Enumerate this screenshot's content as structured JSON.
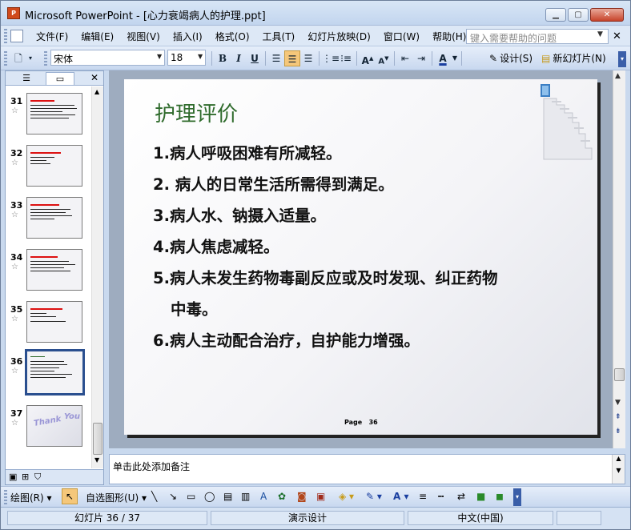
{
  "window": {
    "title": "Microsoft PowerPoint - [心力衰竭病人的护理.ppt]",
    "app_icon_text": "P",
    "btn_min": "▁",
    "btn_max": "▢",
    "btn_close": "✕"
  },
  "menu": {
    "items": [
      "文件(F)",
      "编辑(E)",
      "视图(V)",
      "插入(I)",
      "格式(O)",
      "工具(T)",
      "幻灯片放映(D)",
      "窗口(W)",
      "帮助(H)"
    ],
    "help_placeholder": "键入需要帮助的问题",
    "close_glyph": "✕"
  },
  "toolbar": {
    "font_name": "宋体",
    "font_size": "18",
    "bold": "B",
    "italic": "I",
    "underline": "U",
    "font_color_glyph": "A",
    "design_label": "设计(S)",
    "new_slide_label": "新幻灯片(N)"
  },
  "left_pane": {
    "tab_outline_icon": "outline-icon",
    "tab_slides_icon": "slides-icon",
    "close_glyph": "✕",
    "thumbnails": [
      {
        "number": "31",
        "star": "☆"
      },
      {
        "number": "32",
        "star": "☆"
      },
      {
        "number": "33",
        "star": "☆"
      },
      {
        "number": "34",
        "star": "☆"
      },
      {
        "number": "35",
        "star": "☆"
      },
      {
        "number": "36",
        "star": "☆"
      },
      {
        "number": "37",
        "star": "☆"
      }
    ],
    "thumb37_text_a": "Thank",
    "thumb37_text_b": "You"
  },
  "slide": {
    "title": "护理评价",
    "items": [
      "1.病人呼吸困难有所减轻。",
      "2. 病人的日常生活所需得到满足。",
      "3.病人水、钠摄入适量。",
      "4.病人焦虑减轻。",
      "5.病人未发生药物毒副反应或及时发现、纠正药物",
      "中毒。",
      "6.病人主动配合治疗，自护能力增强。"
    ],
    "page_label": "Page",
    "page_number": "36"
  },
  "notes": {
    "placeholder": "单击此处添加备注"
  },
  "drawing_toolbar": {
    "draw_label": "绘图(R)",
    "autoshapes_label": "自选图形(U)"
  },
  "status": {
    "slide_count": "幻灯片 36 / 37",
    "design_name": "演示设计",
    "language": "中文(中国)"
  },
  "colors": {
    "title_green": "#2f6b2c",
    "selected_border": "#2a4f8f",
    "active_button": "#f5c77a"
  }
}
